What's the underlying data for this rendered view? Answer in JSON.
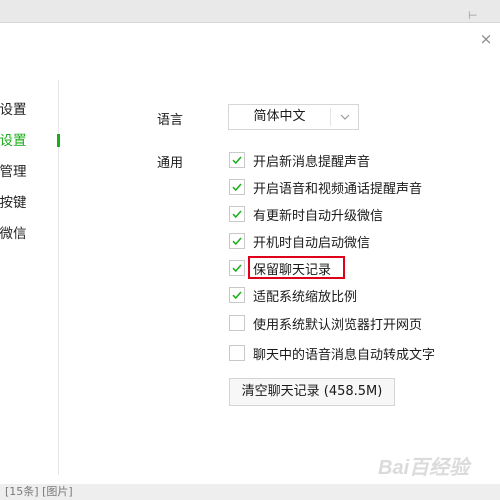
{
  "background": {
    "bottom_text": "[15条] [图片]"
  },
  "dialog": {
    "title_glyph": "s",
    "close_glyph": "×"
  },
  "sidebar": {
    "items": [
      {
        "label": "号设置",
        "active": false
      },
      {
        "label": "用设置",
        "active": true
      },
      {
        "label": "件管理",
        "active": false
      },
      {
        "label": "捷按键",
        "active": false
      },
      {
        "label": "于微信",
        "active": false
      }
    ]
  },
  "settings": {
    "language_label": "语言",
    "language_value": "简体中文",
    "general_label": "通用",
    "options": [
      {
        "label": "开启新消息提醒声音",
        "checked": true
      },
      {
        "label": "开启语音和视频通话提醒声音",
        "checked": true
      },
      {
        "label": "有更新时自动升级微信",
        "checked": true
      },
      {
        "label": "开机时自动启动微信",
        "checked": true
      },
      {
        "label": "保留聊天记录",
        "checked": true
      },
      {
        "label": "适配系统缩放比例",
        "checked": true
      },
      {
        "label": "使用系统默认浏览器打开网页",
        "checked": false
      },
      {
        "label": "聊天中的语音消息自动转成文字",
        "checked": false
      }
    ],
    "clear_button": "清空聊天记录 (458.5M)"
  },
  "colors": {
    "accent": "#1aad19",
    "highlight": "#e1001a"
  },
  "watermark": "Bai百经验"
}
